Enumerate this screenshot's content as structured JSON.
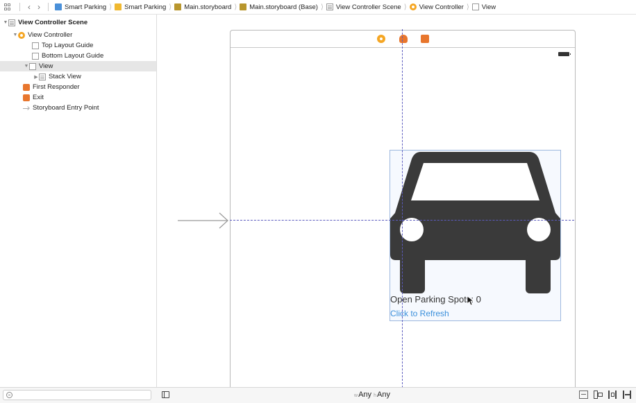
{
  "jumpbar": {
    "crumbs": [
      "Smart Parking",
      "Smart Parking",
      "Main.storyboard",
      "Main.storyboard (Base)",
      "View Controller Scene",
      "View Controller",
      "View"
    ]
  },
  "outline": {
    "scene_title": "View Controller Scene",
    "view_controller": "View Controller",
    "top_layout_guide": "Top Layout Guide",
    "bottom_layout_guide": "Bottom Layout Guide",
    "view": "View",
    "stack_view": "Stack View",
    "first_responder": "First Responder",
    "exit": "Exit",
    "entry_point": "Storyboard Entry Point"
  },
  "canvas": {
    "spots_label": "Open Parking Spots: 0",
    "refresh_label": "Click to Refresh"
  },
  "bottombar": {
    "width_prefix": "w",
    "width_class": "Any",
    "height_prefix": "h",
    "height_class": "Any"
  },
  "colors": {
    "accent_blue": "#3a8fdb",
    "vc_orange": "#f5a623",
    "responder_orange": "#e8762d",
    "guide_blue": "#5c5cbf",
    "car": "#3a3a3a"
  }
}
